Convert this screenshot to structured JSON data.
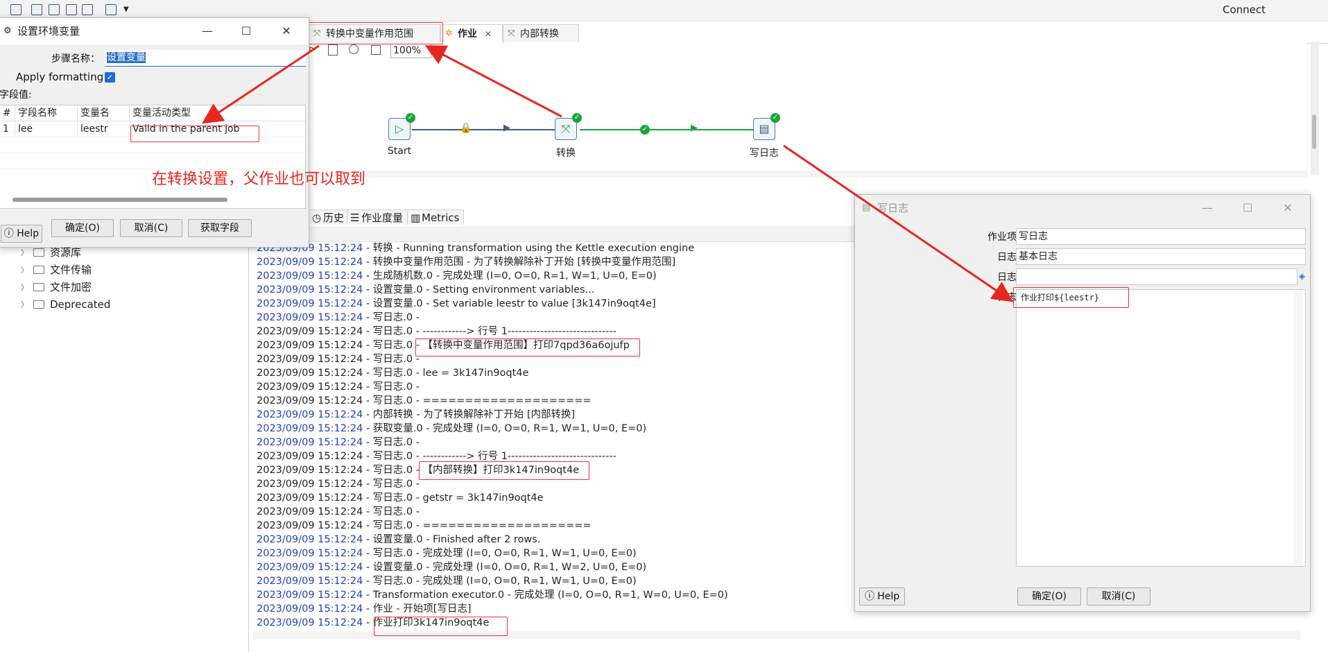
{
  "app": {
    "connect_label": "Connect"
  },
  "tabs": [
    {
      "label": "转换中变量作用范围"
    },
    {
      "label": "作业"
    },
    {
      "label": "内部转换"
    }
  ],
  "canvas": {
    "zoom": "100%",
    "nodes": [
      {
        "label": "Start"
      },
      {
        "label": "转换"
      },
      {
        "label": "写日志"
      }
    ]
  },
  "bottom_tabs": [
    {
      "label": "历史"
    },
    {
      "label": "作业度量"
    },
    {
      "label": "Metrics"
    }
  ],
  "tree": {
    "items": [
      {
        "label": "资源库"
      },
      {
        "label": "文件传输"
      },
      {
        "label": "文件加密"
      },
      {
        "label": "Deprecated"
      }
    ]
  },
  "log": {
    "lines": [
      {
        "ts": "2023/09/09 15:12:24",
        "msg": " - 转换 - Running transformation using the Kettle execution engine",
        "blue": true
      },
      {
        "ts": "2023/09/09 15:12:24",
        "msg": " - 转换中变量作用范围 - 为了转换解除补丁开始  [转换中变量作用范围]",
        "blue": true
      },
      {
        "ts": "2023/09/09 15:12:24",
        "msg": " - 生成随机数.0 - 完成处理 (I=0, O=0, R=1, W=1, U=0, E=0)",
        "blue": true
      },
      {
        "ts": "2023/09/09 15:12:24",
        "msg": " - 设置变量.0 - Setting environment variables...",
        "blue": true
      },
      {
        "ts": "2023/09/09 15:12:24",
        "msg": " - 设置变量.0 - Set variable leestr to value [3k147in9oqt4e]",
        "blue": true
      },
      {
        "ts": "2023/09/09 15:12:24",
        "msg": " - 写日志.0 -",
        "blue": true
      },
      {
        "ts": "2023/09/09 15:12:24",
        "msg": " - 写日志.0 - ------------> 行号 1------------------------------",
        "blue": false
      },
      {
        "ts": "2023/09/09 15:12:24",
        "msg": " - 写日志.0 - 【转换中变量作用范围】打印7qpd36a6ojufp",
        "blue": false
      },
      {
        "ts": "2023/09/09 15:12:24",
        "msg": " - 写日志.0 -",
        "blue": false
      },
      {
        "ts": "2023/09/09 15:12:24",
        "msg": " - 写日志.0 - lee = 3k147in9oqt4e",
        "blue": false
      },
      {
        "ts": "2023/09/09 15:12:24",
        "msg": " - 写日志.0 -",
        "blue": false
      },
      {
        "ts": "2023/09/09 15:12:24",
        "msg": " - 写日志.0 - ====================",
        "blue": false
      },
      {
        "ts": "2023/09/09 15:12:24",
        "msg": " - 内部转换 - 为了转换解除补丁开始  [内部转换]",
        "blue": true
      },
      {
        "ts": "2023/09/09 15:12:24",
        "msg": " - 获取变量.0 - 完成处理 (I=0, O=0, R=1, W=1, U=0, E=0)",
        "blue": true
      },
      {
        "ts": "2023/09/09 15:12:24",
        "msg": " - 写日志.0 -",
        "blue": true
      },
      {
        "ts": "2023/09/09 15:12:24",
        "msg": " - 写日志.0 - ------------> 行号 1------------------------------",
        "blue": false
      },
      {
        "ts": "2023/09/09 15:12:24",
        "msg": " - 写日志.0 - 【内部转换】打印3k147in9oqt4e",
        "blue": false
      },
      {
        "ts": "2023/09/09 15:12:24",
        "msg": " - 写日志.0 -",
        "blue": false
      },
      {
        "ts": "2023/09/09 15:12:24",
        "msg": " - 写日志.0 - getstr = 3k147in9oqt4e",
        "blue": false
      },
      {
        "ts": "2023/09/09 15:12:24",
        "msg": " - 写日志.0 -",
        "blue": false
      },
      {
        "ts": "2023/09/09 15:12:24",
        "msg": " - 写日志.0 - ====================",
        "blue": false
      },
      {
        "ts": "2023/09/09 15:12:24",
        "msg": " - 设置变量.0 - Finished after 2 rows.",
        "blue": true
      },
      {
        "ts": "2023/09/09 15:12:24",
        "msg": " - 写日志.0 - 完成处理 (I=0, O=0, R=1, W=1, U=0, E=0)",
        "blue": true
      },
      {
        "ts": "2023/09/09 15:12:24",
        "msg": " - 设置变量.0 - 完成处理 (I=0, O=0, R=1, W=2, U=0, E=0)",
        "blue": true
      },
      {
        "ts": "2023/09/09 15:12:24",
        "msg": " - 写日志.0 - 完成处理 (I=0, O=0, R=1, W=1, U=0, E=0)",
        "blue": true
      },
      {
        "ts": "2023/09/09 15:12:24",
        "msg": " - Transformation executor.0 - 完成处理 (I=0, O=0, R=1, W=0, U=0, E=0)",
        "blue": true
      },
      {
        "ts": "2023/09/09 15:12:24",
        "msg": " - 作业 - 开始项[写日志]",
        "blue": true
      },
      {
        "ts": "2023/09/09 15:12:24",
        "msg": " -  作业打印3k147in9oqt4e",
        "blue": true
      }
    ]
  },
  "set_env_dialog": {
    "title": "设置环境变量",
    "step_name_label": "步骤名称：",
    "step_name_value": "设置变量",
    "apply_formatting_label": "Apply formatting",
    "fields_label": "字段值:",
    "columns": [
      "#",
      "字段名称",
      "变量名",
      "变量活动类型"
    ],
    "rows": [
      {
        "num": "1",
        "field": "lee",
        "var": "leestr",
        "type": "Valid in the parent job"
      }
    ],
    "help_label": "Help",
    "ok_label": "确定(O)",
    "cancel_label": "取消(C)",
    "get_fields_label": "获取字段"
  },
  "annotation_text": "在转换设置，父作业也可以取到",
  "write_log_dialog": {
    "title": "写日志",
    "job_entry_name_label": "作业项名称",
    "job_entry_name_value": "写日志",
    "log_level_label": "日志级别",
    "log_level_value": "基本日志",
    "log_subject_label": "日志主题",
    "log_subject_value": "",
    "log_message_label": "日志消息",
    "log_message_value": "作业打印${leestr}",
    "help_label": "Help",
    "ok_label": "确定(O)",
    "cancel_label": "取消(C)"
  },
  "colors": {
    "annotation": "#e6261f",
    "timestamp": "#1f3fbf",
    "ok_green": "#1aa53a"
  }
}
